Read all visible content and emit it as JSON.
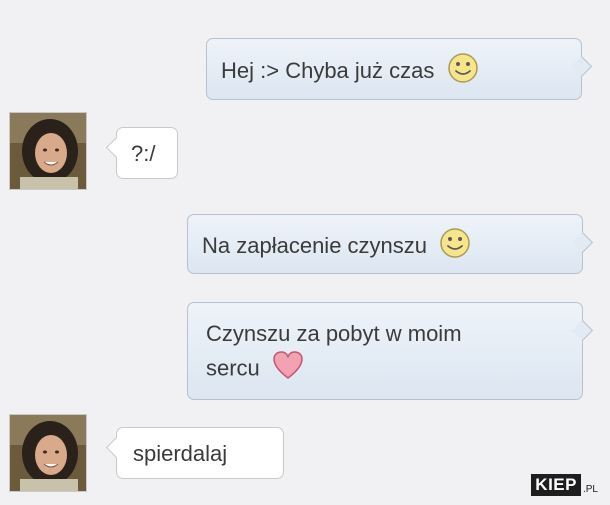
{
  "conversation": {
    "messages": [
      {
        "side": "sent",
        "text": "Hej :> Chyba już czas",
        "icon": "smiley-icon"
      },
      {
        "side": "received",
        "text": "?:/"
      },
      {
        "side": "sent",
        "text": "Na zapłacenie czynszu",
        "icon": "smiley-icon"
      },
      {
        "side": "sent",
        "line1": "Czynszu za pobyt w moim",
        "line2": "sercu",
        "icon": "heart-icon"
      },
      {
        "side": "received",
        "text": "spierdalaj"
      }
    ]
  },
  "watermark": {
    "main": "KIEP",
    "suffix": ".PL"
  },
  "colors": {
    "background": "#f1f1f3",
    "sent_bubble": "#dce6f1",
    "received_bubble": "#ffffff",
    "heart": "#f3a1b3",
    "smiley": "#f6e58a"
  }
}
